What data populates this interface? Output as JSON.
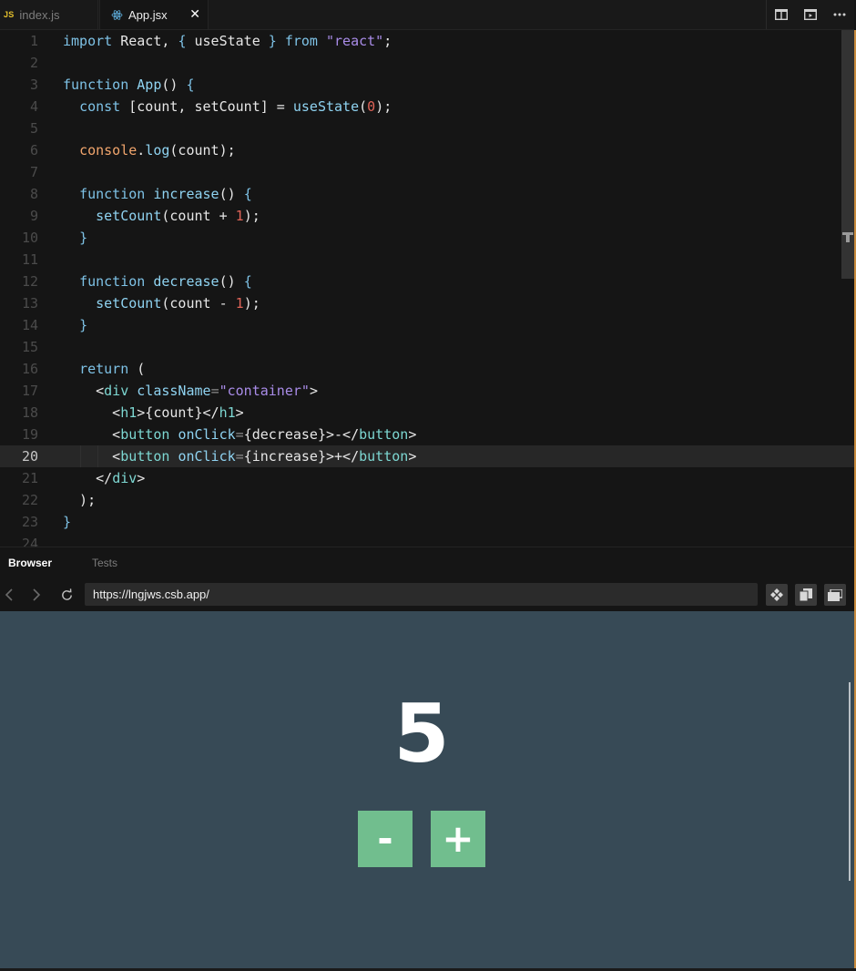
{
  "tabs": [
    {
      "badge": "JS",
      "label": "index.js",
      "active": false,
      "icon": "js-icon"
    },
    {
      "label": "App.jsx",
      "active": true,
      "icon": "react-icon",
      "close": "✕"
    }
  ],
  "tab_actions": [
    "split-view-icon",
    "preview-icon",
    "more-icon"
  ],
  "editor": {
    "active_line": 20,
    "line_numbers": [
      "1",
      "2",
      "3",
      "4",
      "5",
      "6",
      "7",
      "8",
      "9",
      "10",
      "11",
      "12",
      "13",
      "14",
      "15",
      "16",
      "17",
      "18",
      "19",
      "20",
      "21",
      "22",
      "23",
      "24"
    ]
  },
  "panel": {
    "tabs": [
      {
        "label": "Browser",
        "active": true
      },
      {
        "label": "Tests",
        "active": false
      }
    ]
  },
  "browser": {
    "url": "https://lngjws.csb.app/",
    "buttons": [
      "back-icon",
      "forward-icon",
      "refresh-icon",
      "codesandbox-icon",
      "copy-icon",
      "new-window-icon"
    ]
  },
  "app": {
    "count": "5",
    "decrease_label": "-",
    "increase_label": "+"
  },
  "colors": {
    "editor_bg": "#151515",
    "preview_bg": "#374a56",
    "button_green": "#71be8e",
    "keyword": "#7ec2e6",
    "string": "#a98ce8",
    "number": "#e06458"
  }
}
